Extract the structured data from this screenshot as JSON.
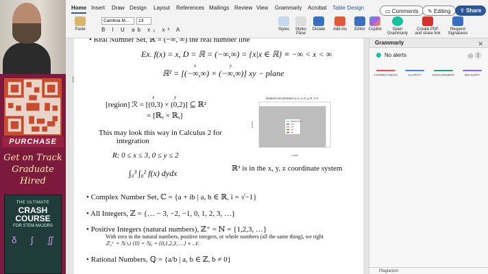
{
  "sidebar": {
    "purchase_label": "PURCHASE",
    "promo_lines": [
      "Get on Track",
      "Graduate",
      "Hired"
    ],
    "book": {
      "top": "THE ULTIMATE",
      "title_lines": [
        "CRASH COURSE"
      ],
      "subtitle": "FOR STEM MAJORS",
      "symbols": [
        "δ",
        "∫",
        "∬"
      ]
    }
  },
  "ribbon": {
    "tabs": [
      "Home",
      "Insert",
      "Draw",
      "Design",
      "Layout",
      "References",
      "Mailings",
      "Review",
      "View",
      "Grammarly",
      "Acrobat",
      "Table Design"
    ],
    "comments_label": "Comments",
    "editing_label": "Editing",
    "share_label": "Share",
    "paste_label": "Paste",
    "font_name": "Cambria M...",
    "font_size": "13",
    "format_row": "B I U ab x₂ x² A",
    "tools": [
      {
        "label": "Styles"
      },
      {
        "label": "Styles Pane"
      },
      {
        "label": "Dictate"
      },
      {
        "label": "Add-ins"
      },
      {
        "label": "Editor"
      },
      {
        "label": "Copilot"
      },
      {
        "label": "Open Grammarly"
      },
      {
        "label": "Create PDF and share link"
      },
      {
        "label": "Request Signatures"
      }
    ]
  },
  "document": {
    "line_top": "• Real Number Set, ℝ = (−∞, ∞) the real number line",
    "ex_line": "Ex. f(x) = x,  D = ℝ = (−∞,∞) = {x|x ∈ ℝ} ≡ −∞ < x < ∞",
    "r2_line": "ℝ² = [(−∞,∞) × (−∞,∞)] xy − plane",
    "r2_x": "x",
    "r2_y": "y",
    "region_line": "[region] ℛ = [(0,3) × (0,2)] ⊆ ℝ²",
    "region_x": "x",
    "region_y": "y",
    "region_line2": "= [ℝₓ × ℝᵧ]",
    "calc_line1": "This may look this way in Calculus 2 for",
    "calc_line2": "integration",
    "bounds_line": "R:  0 ≤ x ≤ 3,       0 ≤ y ≤ 2",
    "integral_line": "∫₀³ ∫₀² f(x) dydx",
    "r3_line": "ℝ³ is in the x, y, z coordinate system",
    "complex_line": "• Complex Number Set, ℂ = {a + ib | a, b ∈ ℝ, i = √−1}",
    "integers_line": "• All Integers, ℤ = {… − 3, −2, −1, 0, 1, 2, 3, …}",
    "positive_line": "• Positive Integers (natural numbers), ℤ⁺ = ℕ = {1,2,3, …}",
    "zero_note1": "With zero in the natural numbers, positive integers, or whole numbers (all the same thing), we right",
    "zero_note2": "ℤ₀⁺ = ℕ ∪ {0} = ℕ₀ = {0,1,2,3, …} ≡ 𝒩.",
    "rational_line": "• Rational Numbers, ℚ = {a/b | a, b ∈ ℤ, b ≠ 0}"
  },
  "chart_data": {
    "type": "area",
    "title": "Shaded Area between y=2, x=3, y=0, x=0",
    "xlabel": "x-axis",
    "ylabel": "y-axis",
    "legend": [
      "Shaded Area",
      "y=2",
      "x=3",
      "y=0",
      "x=0"
    ],
    "region": {
      "x": [
        0,
        3
      ],
      "y": [
        0,
        2
      ]
    }
  },
  "grammarly": {
    "title": "Grammarly",
    "alerts": "No alerts",
    "categories": [
      {
        "label": "CORRECTNESS",
        "color": "#e5484d"
      },
      {
        "label": "CLARITY",
        "color": "#3b82f6"
      },
      {
        "label": "ENGAGEMENT",
        "color": "#15a37a"
      },
      {
        "label": "DELIVERY",
        "color": "#8b5cf6"
      }
    ],
    "plagiarism": "Plagiarism"
  }
}
